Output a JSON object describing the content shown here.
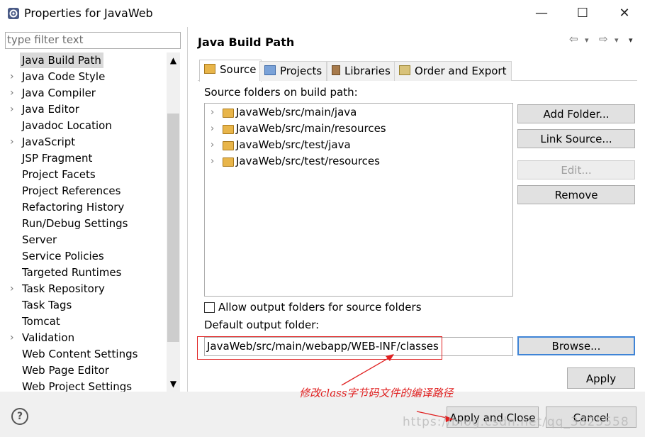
{
  "window": {
    "title": "Properties for JavaWeb",
    "minimize": "—",
    "maximize": "☐",
    "close": "✕"
  },
  "sidebar": {
    "filter_placeholder": "type filter text",
    "items": [
      {
        "label": "Java Build Path",
        "arrow": "",
        "selected": true
      },
      {
        "label": "Java Code Style",
        "arrow": "›"
      },
      {
        "label": "Java Compiler",
        "arrow": "›"
      },
      {
        "label": "Java Editor",
        "arrow": "›"
      },
      {
        "label": "Javadoc Location",
        "arrow": ""
      },
      {
        "label": "JavaScript",
        "arrow": "›"
      },
      {
        "label": "JSP Fragment",
        "arrow": ""
      },
      {
        "label": "Project Facets",
        "arrow": ""
      },
      {
        "label": "Project References",
        "arrow": ""
      },
      {
        "label": "Refactoring History",
        "arrow": ""
      },
      {
        "label": "Run/Debug Settings",
        "arrow": ""
      },
      {
        "label": "Server",
        "arrow": ""
      },
      {
        "label": "Service Policies",
        "arrow": ""
      },
      {
        "label": "Targeted Runtimes",
        "arrow": ""
      },
      {
        "label": "Task Repository",
        "arrow": "›"
      },
      {
        "label": "Task Tags",
        "arrow": ""
      },
      {
        "label": "Tomcat",
        "arrow": ""
      },
      {
        "label": "Validation",
        "arrow": "›"
      },
      {
        "label": "Web Content Settings",
        "arrow": ""
      },
      {
        "label": "Web Page Editor",
        "arrow": ""
      },
      {
        "label": "Web Project Settings",
        "arrow": ""
      }
    ]
  },
  "page": {
    "title": "Java Build Path",
    "nav": {
      "back": "⇦",
      "back_menu": "▾",
      "forward": "⇨",
      "forward_menu": "▾",
      "menu": "▾"
    },
    "tabs": [
      {
        "label": "Source",
        "active": true,
        "icon": "source-folder-icon"
      },
      {
        "label": "Projects",
        "active": false,
        "icon": "projects-icon"
      },
      {
        "label": "Libraries",
        "active": false,
        "icon": "libraries-icon"
      },
      {
        "label": "Order and Export",
        "active": false,
        "icon": "order-export-icon"
      }
    ],
    "source_label": "Source folders on build path:",
    "folders": [
      "JavaWeb/src/main/java",
      "JavaWeb/src/main/resources",
      "JavaWeb/src/test/java",
      "JavaWeb/src/test/resources"
    ],
    "buttons": {
      "add_folder": "Add Folder...",
      "link_source": "Link Source...",
      "edit": "Edit...",
      "remove": "Remove",
      "browse": "Browse...",
      "apply": "Apply"
    },
    "allow_output_label": "Allow output folders for source folders",
    "default_output_label": "Default output folder:",
    "default_output_value": "JavaWeb/src/main/webapp/WEB-INF/classes"
  },
  "footer": {
    "help": "?",
    "apply_close": "Apply and Close",
    "cancel": "Cancel"
  },
  "annotation": {
    "text": "修改class字节码文件的编译路径",
    "color": "#e02020"
  },
  "watermark": "https://blog.csdn.net/qq_3825558"
}
